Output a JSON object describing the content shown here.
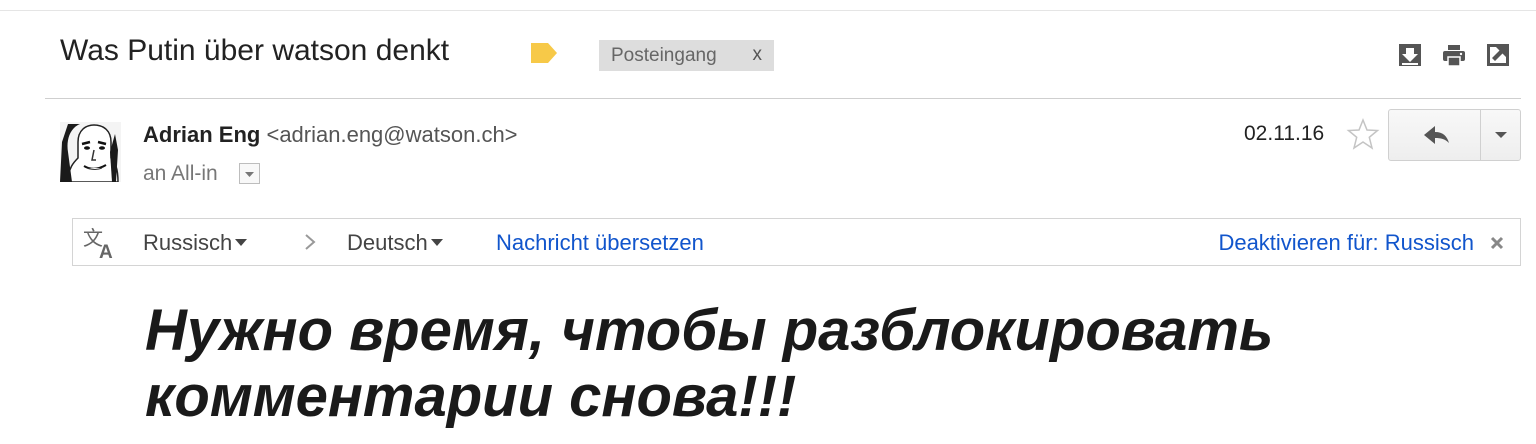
{
  "thread": {
    "subject": "Was Putin über watson denkt",
    "label_chip": "Posteingang",
    "label_chip_remove": "x"
  },
  "message": {
    "sender_name": "Adrian Eng",
    "sender_email": "<adrian.eng@watson.ch>",
    "recipient": "an All-in",
    "date": "02.11.16"
  },
  "translate_bar": {
    "source_language": "Russisch",
    "target_language": "Deutsch",
    "translate_link": "Nachricht übersetzen",
    "disable_link": "Deaktivieren für: Russisch"
  },
  "body": {
    "text": "Нужно время, чтобы разблокировать комментарии снова!!!"
  },
  "colors": {
    "link": "#1155cc",
    "label_tag": "#f7c948",
    "chip_bg": "#dddddd"
  },
  "icons": [
    "label-tag-icon",
    "download-icon",
    "print-icon",
    "open-in-new-window-icon",
    "star-icon",
    "reply-icon",
    "chevron-down-icon",
    "translate-icon",
    "close-icon"
  ]
}
